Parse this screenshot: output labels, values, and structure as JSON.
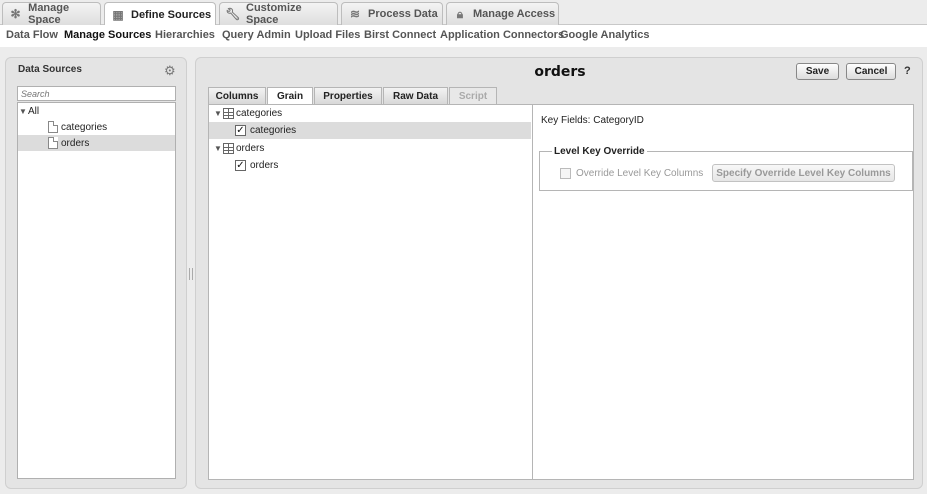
{
  "top_tabs": [
    {
      "label": "Manage Space",
      "icon": "settings-wheel-icon"
    },
    {
      "label": "Define Sources",
      "icon": "grid-icon"
    },
    {
      "label": "Customize Space",
      "icon": "wrench-icon"
    },
    {
      "label": "Process Data",
      "icon": "database-icon"
    },
    {
      "label": "Manage Access",
      "icon": "lock-icon"
    }
  ],
  "subnav": [
    "Data Flow",
    "Manage Sources",
    "Hierarchies",
    "Query Admin",
    "Upload Files",
    "Birst Connect",
    "Application Connectors",
    "Google Analytics"
  ],
  "left_panel": {
    "title": "Data Sources",
    "search_placeholder": "Search",
    "tree": {
      "root": "All",
      "items": [
        "categories",
        "orders"
      ]
    }
  },
  "right_panel": {
    "title": "orders",
    "save_label": "Save",
    "cancel_label": "Cancel",
    "help_label": "?",
    "tabs": [
      "Columns",
      "Grain",
      "Properties",
      "Raw Data",
      "Script"
    ],
    "grain_tree": [
      {
        "table": "categories",
        "child": "categories"
      },
      {
        "table": "orders",
        "child": "orders"
      }
    ],
    "key_fields": "Key Fields: CategoryID",
    "level_key": {
      "legend": "Level Key Override",
      "checkbox_label": "Override Level Key Columns",
      "button_label": "Specify Override Level Key Columns"
    }
  }
}
